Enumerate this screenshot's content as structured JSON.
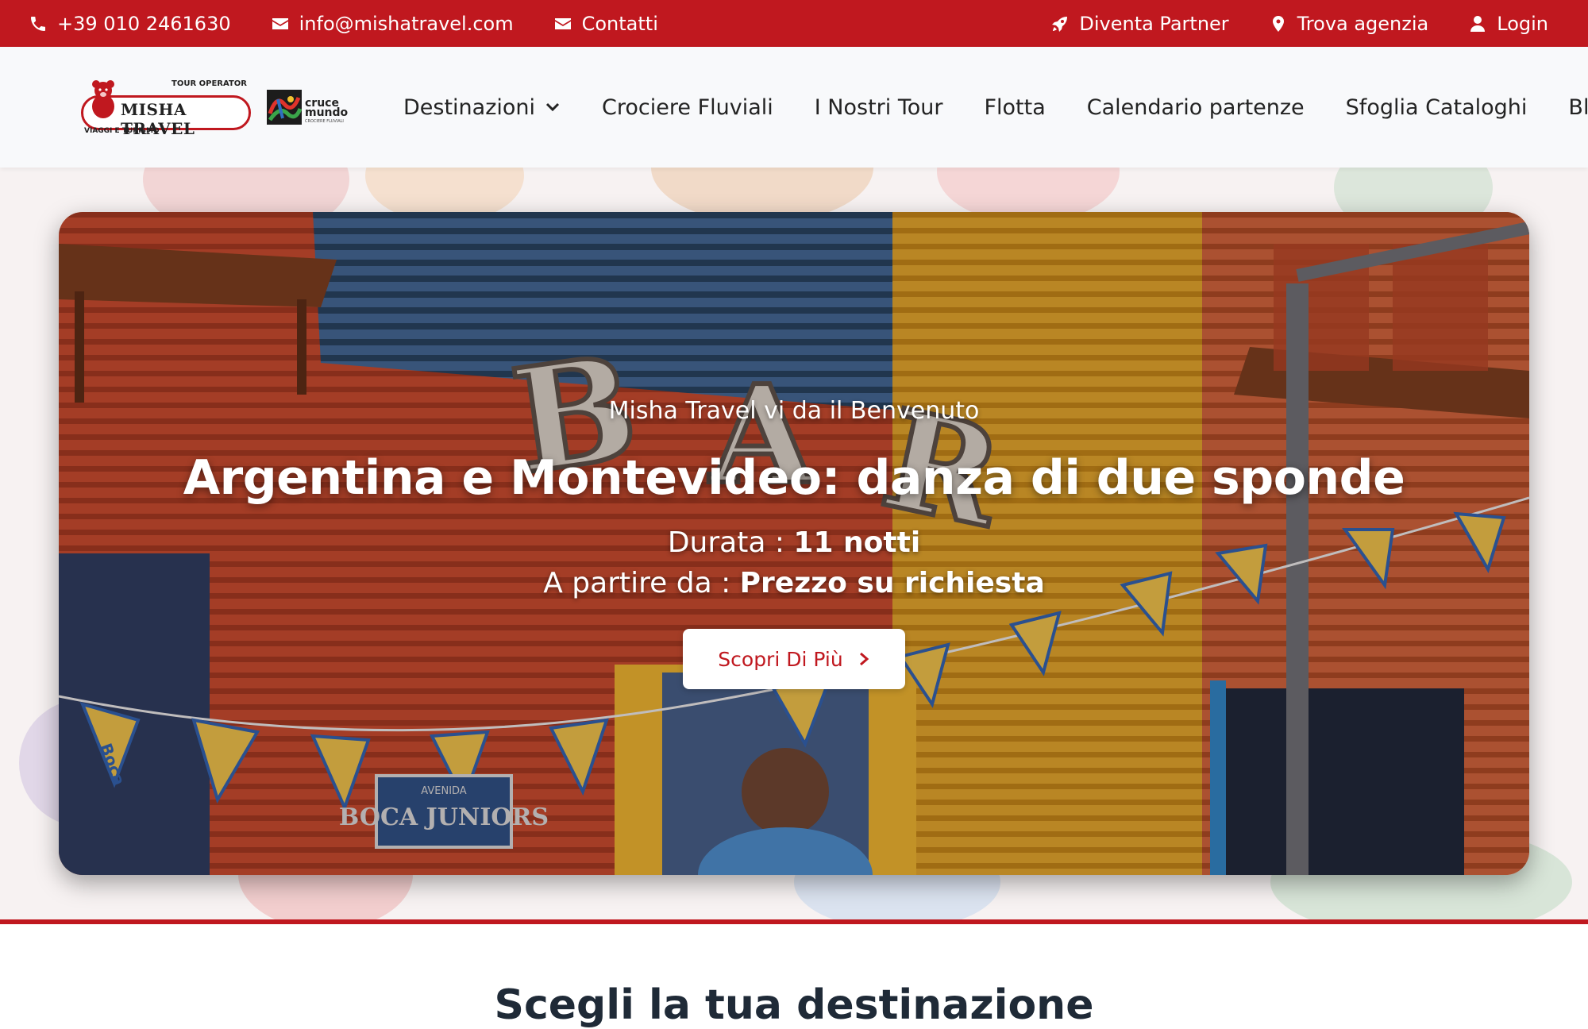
{
  "topbar": {
    "phone": "+39 010 2461630",
    "email": "info@mishatravel.com",
    "contacts": "Contatti",
    "partner": "Diventa Partner",
    "agency": "Trova agenzia",
    "login": "Login",
    "background_color": "#c0181f"
  },
  "logos": {
    "misha_tour": "TOUR OPERATOR",
    "misha_name": "MISHA TRAVEL",
    "misha_sub": "VIAGGI E TURISMO",
    "cruce_line1": "cruce",
    "cruce_line2": "mundo",
    "cruce_line3": "CROCIERE FLUVIALI"
  },
  "nav": {
    "items": [
      {
        "label": "Destinazioni",
        "icon": "chevron-down-icon"
      },
      {
        "label": "Crociere Fluviali"
      },
      {
        "label": "I Nostri Tour"
      },
      {
        "label": "Flotta"
      },
      {
        "label": "Calendario partenze"
      },
      {
        "label": "Sfoglia Cataloghi"
      },
      {
        "label": "Blog"
      }
    ]
  },
  "hero": {
    "welcome": "Misha Travel vi da il Benvenuto",
    "title": "Argentina e Montevideo: danza di due sponde",
    "duration_label": "Durata : ",
    "duration_value": "11 notti",
    "price_label": "A partire da : ",
    "price_value": "Prezzo su richiesta",
    "cta_label": "Scopri Di Più",
    "photo_texts": {
      "sign_letters": "BAR",
      "street_sign_top": "AVENIDA",
      "street_sign": "BOCA JUNIORS",
      "flag_text": "Boca"
    }
  },
  "section": {
    "title": "Scegli la tua destinazione"
  },
  "colors": {
    "accent": "#c0181f",
    "cta_text": "#c0181f"
  }
}
